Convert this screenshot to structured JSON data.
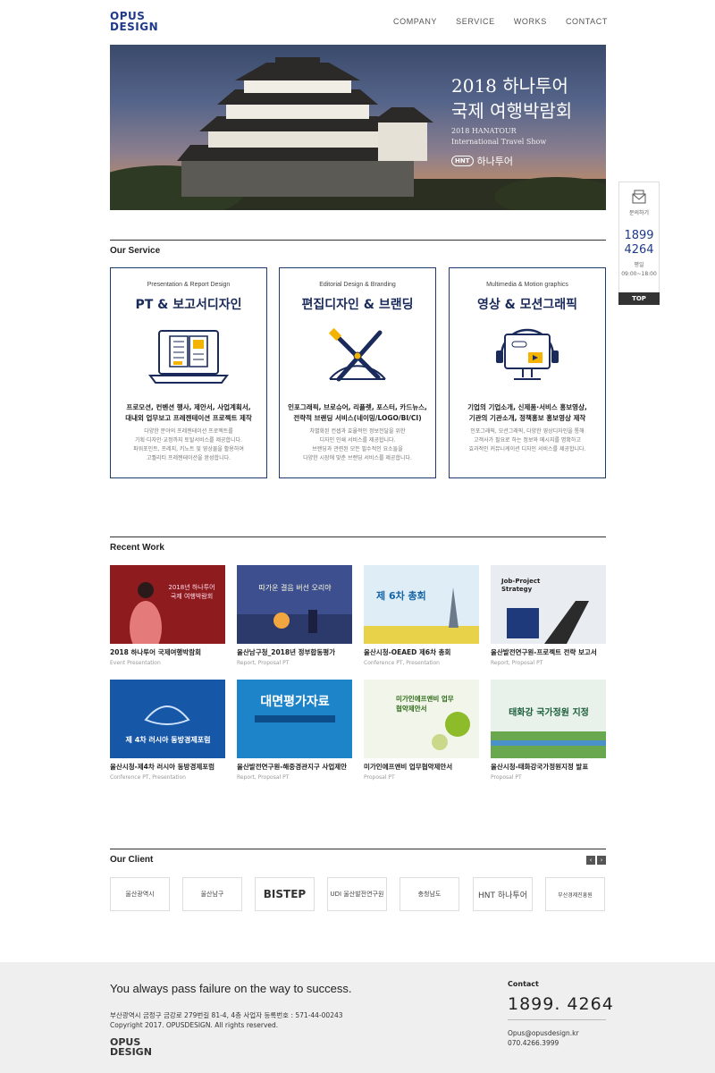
{
  "header": {
    "logo_line1": "OPUS",
    "logo_line2": "DESIGN",
    "nav": [
      "COMPANY",
      "SERVICE",
      "WORKS",
      "CONTACT"
    ]
  },
  "hero": {
    "title_line1": "2018 하나투어",
    "title_line2": "국제 여행박람회",
    "subtitle_line1": "2018 HANATOUR",
    "subtitle_line2": "International Travel Show",
    "brand_badge": "HNT",
    "brand_name": "하나투어"
  },
  "quick_panel": {
    "ask_label": "문의하기",
    "phone_line1": "1899",
    "phone_line2": "4264",
    "hours_label": "평일",
    "hours": "09:00~18:00",
    "top_label": "TOP"
  },
  "service": {
    "heading": "Our Service",
    "cards": [
      {
        "sub": "Presentation & Report Design",
        "title": "PT & 보고서디자인",
        "icon": "laptop-document-icon",
        "desc_bold_1": "프로모션, 컨벤션 행사, 제안서, 사업계획서,",
        "desc_bold_2": "대내외 업무보고 프레젠테이션 프로젝트 제작",
        "desc_1": "다양한 분야의 프레젠테이션 프로젝트를",
        "desc_2": "기획·디자인·교정까지 토탈서비스를 제공합니다.",
        "desc_3": "파워포인트, 프레지, 키노트 및 영상물을 활용하여",
        "desc_4": "고퀄리티 프레젠테이션을 완성합니다."
      },
      {
        "sub": "Editorial Design & Branding",
        "title": "편집디자인 & 브랜딩",
        "icon": "design-tools-icon",
        "desc_bold_1": "인포그래픽, 브로슈어, 리플렛, 포스터, 카드뉴스,",
        "desc_bold_2": "전략적 브랜딩 서비스(네이밍/LOGO/BI/CI)",
        "desc_1": "차별화된 컨셉과 효율적인 정보전달을 위한",
        "desc_2": "디자인 인쇄 서비스를 제공합니다.",
        "desc_3": "브랜딩과 관련된 모든 필수적인 요소들을",
        "desc_4": "다양한 시장에 맞춘 브랜딩 서비스를 제공합니다."
      },
      {
        "sub": "Multimedia & Motion graphics",
        "title": "영상 & 모션그래픽",
        "icon": "monitor-headset-icon",
        "desc_bold_1": "기업의 기업소개, 신제품·서비스 홍보영상,",
        "desc_bold_2": "기관의 기관소개, 정책홍보 홍보영상 제작",
        "desc_1": "인포그래픽, 모션그래픽, 다양한 영상디자인을 통해",
        "desc_2": "고객사가 필요로 하는 정보와 메시지를 명확하고",
        "desc_3": "효과적인 커뮤니케이션 디자인 서비스를 제공합니다.",
        "desc_4": ""
      }
    ]
  },
  "recent": {
    "heading": "Recent Work",
    "items": [
      {
        "caption": "2018 하나투어 국제여행박람회",
        "category": "Event Presentation",
        "thumb_text": "2018년 하나투어 국제 여행박람회",
        "bg": "#8e1b1d"
      },
      {
        "caption": "울산남구청_2018년 정부합동평가",
        "category": "Report, Proposal PT",
        "thumb_text": "따가운 결음 버선 오리야",
        "bg": "#3d4f8f"
      },
      {
        "caption": "울산시청-OEAED 제6차 총회",
        "category": "Conference PT, Presentation",
        "thumb_text": "제 6차 총회",
        "bg": "#dfeef6"
      },
      {
        "caption": "울산발전연구원-프로젝트 전략 보고서",
        "category": "Report, Proposal PT",
        "thumb_text": "Job-Project Strategy",
        "bg": "#e9ecf1"
      },
      {
        "caption": "울산시청-제4차 러시아 동방경제포럼",
        "category": "Conference PT, Presentation",
        "thumb_text": "제 4차 러시아 동방경제포럼",
        "bg": "#1657a8"
      },
      {
        "caption": "울산발전연구원-해중경관지구 사업제안",
        "category": "Report, Proposal PT",
        "thumb_text": "대면평가자료",
        "bg": "#1e84c9"
      },
      {
        "caption": "미가인에프앤비 업무협약제안서",
        "category": "Proposal PT",
        "thumb_text": "미가인에프앤비 업무협약제안서",
        "bg": "#f2f6ea"
      },
      {
        "caption": "울산시청-태화강국가정원지정 발표",
        "category": "Proposal PT",
        "thumb_text": "태화강 국가정원 지정",
        "bg": "#e8f2ea"
      }
    ]
  },
  "clients": {
    "heading": "Our Client",
    "prev_icon": "‹",
    "next_icon": "›",
    "items": [
      "울산광역시",
      "울산남구",
      "BISTEP",
      "UDI 울산발전연구원",
      "충청남도",
      "HNT 하나투어",
      "부산경제진흥원"
    ]
  },
  "footer": {
    "slogan": "You always pass failure on the way to success.",
    "address": "부산광역시 금정구 금강로 279번길 81-4, 4층 사업자 등록번호 : 571-44-00243",
    "copyright": "Copyright 2017. OPUSDESIGN. All rights reserved.",
    "logo_line1": "OPUS",
    "logo_line2": "DESIGN",
    "contact_label": "Contact",
    "phone": "1899. 4264",
    "email": "Opus@opusdesign.kr",
    "tel": "070.4266.3999"
  }
}
